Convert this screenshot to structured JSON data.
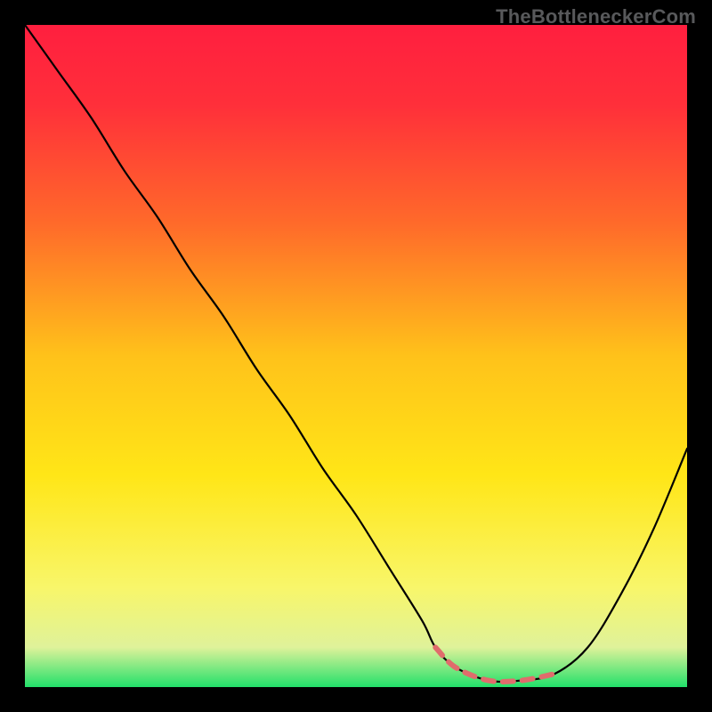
{
  "watermark": "TheBottleneckerCom",
  "chart_data": {
    "type": "line",
    "title": "",
    "xlabel": "",
    "ylabel": "",
    "xlim": [
      0,
      100
    ],
    "ylim": [
      0,
      100
    ],
    "gradient_stops": [
      {
        "offset": 0.0,
        "color": "#ff1f3f"
      },
      {
        "offset": 0.12,
        "color": "#ff2f3a"
      },
      {
        "offset": 0.3,
        "color": "#ff6a2a"
      },
      {
        "offset": 0.5,
        "color": "#ffc21a"
      },
      {
        "offset": 0.68,
        "color": "#ffe617"
      },
      {
        "offset": 0.85,
        "color": "#f8f66a"
      },
      {
        "offset": 0.94,
        "color": "#dff29a"
      },
      {
        "offset": 1.0,
        "color": "#22e06a"
      }
    ],
    "series": [
      {
        "name": "bottleneck-curve",
        "stroke": "#000000",
        "stroke_width": 2.2,
        "x": [
          0,
          5,
          10,
          15,
          20,
          25,
          30,
          35,
          40,
          45,
          50,
          55,
          60,
          62,
          65,
          70,
          75,
          80,
          85,
          90,
          95,
          100
        ],
        "y": [
          100,
          93,
          86,
          78,
          71,
          63,
          56,
          48,
          41,
          33,
          26,
          18,
          10,
          6,
          3,
          1,
          1,
          2,
          6,
          14,
          24,
          36
        ]
      }
    ],
    "flat_marker": {
      "stroke": "#e06c6c",
      "stroke_width": 6,
      "dash": "12 10",
      "x": [
        62,
        65,
        70,
        75,
        80
      ],
      "y": [
        6,
        3,
        1,
        1,
        2
      ]
    }
  }
}
